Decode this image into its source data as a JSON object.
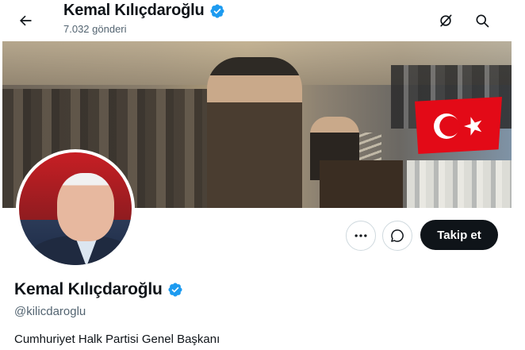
{
  "header": {
    "name": "Kemal Kılıçdaroğlu",
    "post_count": "7.032 gönderi",
    "icons": [
      "back-arrow-icon",
      "verified-badge-icon",
      "grok-icon",
      "search-icon"
    ]
  },
  "profile": {
    "display_name": "Kemal Kılıçdaroğlu",
    "handle": "@kilicdaroglu",
    "bio": "Cumhuriyet Halk Partisi Genel Başkanı"
  },
  "actions": {
    "more_label": "···",
    "follow_label": "Takip et",
    "icons": [
      "more-icon",
      "grok-chat-icon"
    ]
  },
  "colors": {
    "verified": "#1d9bf0",
    "follow_bg": "#0f1419",
    "secondary_text": "#536471"
  }
}
